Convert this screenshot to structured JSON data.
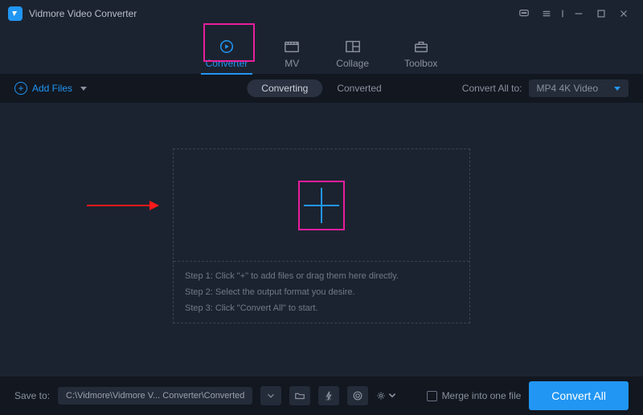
{
  "app": {
    "title": "Vidmore Video Converter"
  },
  "tabs": {
    "converter": "Converter",
    "mv": "MV",
    "collage": "Collage",
    "toolbox": "Toolbox"
  },
  "toolbar": {
    "add_files": "Add Files",
    "converting": "Converting",
    "converted": "Converted",
    "convert_all_to": "Convert All to:",
    "format": "MP4 4K Video"
  },
  "drop": {
    "steps": [
      "Step 1: Click \"+\" to add files or drag them here directly.",
      "Step 2: Select the output format you desire.",
      "Step 3: Click \"Convert All\" to start."
    ]
  },
  "footer": {
    "save_to": "Save to:",
    "path": "C:\\Vidmore\\Vidmore V... Converter\\Converted",
    "merge": "Merge into one file",
    "convert_all": "Convert All"
  }
}
